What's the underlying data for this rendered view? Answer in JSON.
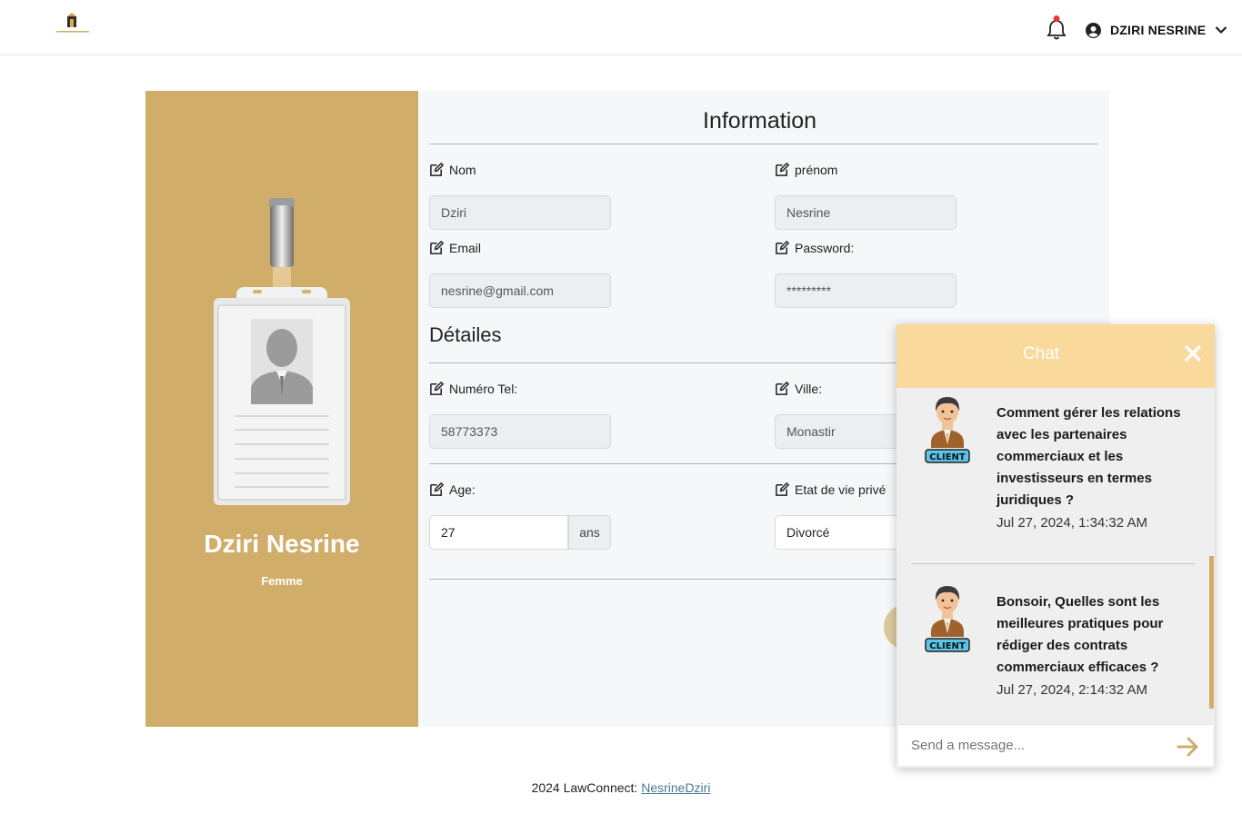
{
  "header": {
    "user_name": "DZIRI NESRINE",
    "has_notification": true
  },
  "profile": {
    "name": "Dziri Nesrine",
    "gender": "Femme"
  },
  "information": {
    "title": "Information",
    "nom": {
      "label": "Nom",
      "value": "Dziri"
    },
    "prenom": {
      "label": "prénom",
      "value": "Nesrine"
    },
    "email": {
      "label": "Email",
      "value": "nesrine@gmail.com"
    },
    "password": {
      "label": "Password:",
      "value": "*********"
    }
  },
  "details": {
    "title": "Détailes",
    "tel": {
      "label": "Numéro Tel:",
      "value": "58773373"
    },
    "ville": {
      "label": "Ville:",
      "value": "Monastir"
    },
    "age": {
      "label": "Age:",
      "value": "27",
      "suffix": "ans"
    },
    "etat": {
      "label": "Etat de vie privé",
      "value": "Divorcé"
    }
  },
  "chat": {
    "title": "Chat",
    "input_placeholder": "Send a message...",
    "messages": [
      {
        "avatar_label": "CLIENT",
        "text": "Comment gérer les relations avec les partenaires commerciaux et les investisseurs en termes juridiques ?",
        "time": "Jul 27, 2024, 1:34:32 AM"
      },
      {
        "avatar_label": "CLIENT",
        "text": "Bonsoir, Quelles sont les meilleures pratiques pour rédiger des contrats commerciaux efficaces ?",
        "time": "Jul 27, 2024, 2:14:32 AM"
      }
    ]
  },
  "footer": {
    "text": "2024 LawConnect: ",
    "link": "NesrineDziri"
  },
  "colors": {
    "accent_gold": "#d1ad6a",
    "chat_header": "#fad99c",
    "notification_dot": "#e53935"
  },
  "icons": [
    "logo-icon",
    "bell-icon",
    "user-circle-icon",
    "chevron-down-icon",
    "edit-icon",
    "close-icon",
    "send-arrow-icon",
    "client-avatar-icon",
    "id-badge-image"
  ]
}
